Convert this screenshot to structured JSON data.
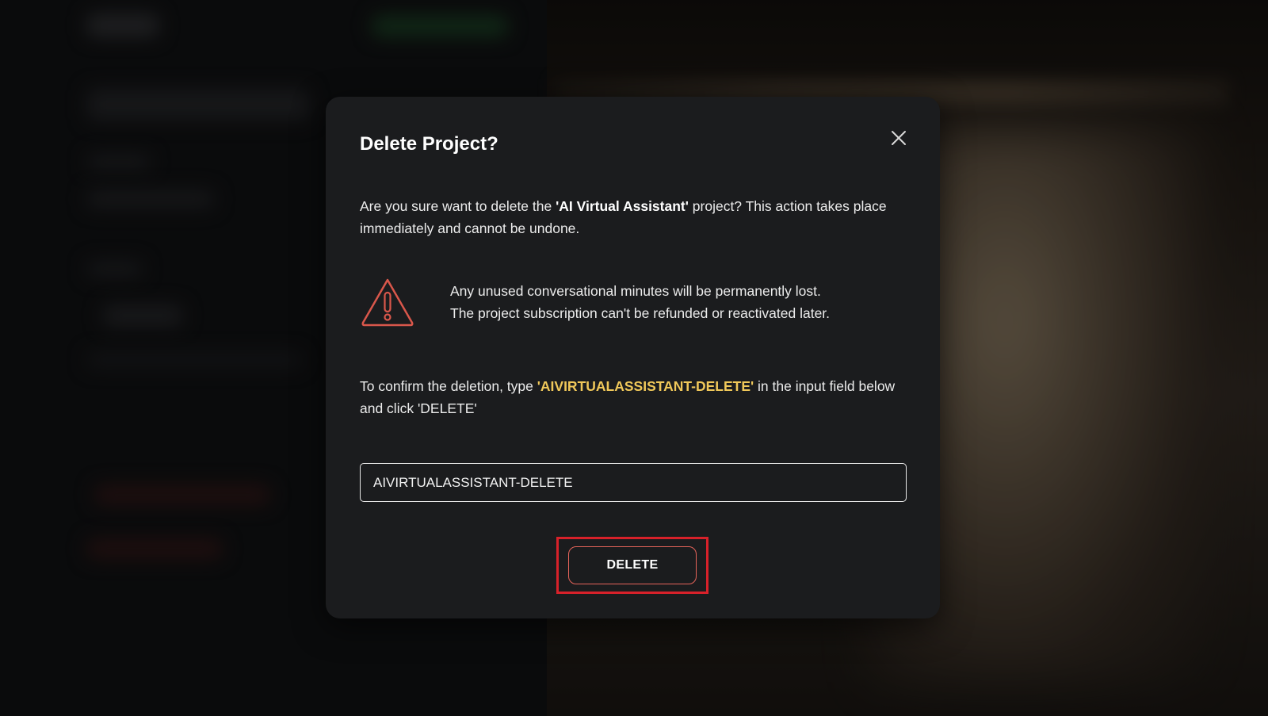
{
  "modal": {
    "title": "Delete Project?",
    "intro_prefix": "Are you sure want to delete the ",
    "project_name_quoted": "'AI Virtual Assistant'",
    "intro_suffix": " project? This action takes place immediately and cannot be undone.",
    "warning_line_1": "Any unused conversational minutes will be permanently lost.",
    "warning_line_2": "The project subscription can't be refunded or reactivated later.",
    "confirm_prefix": "To confirm the deletion, type ",
    "confirm_code_quoted": "'AIVIRTUALASSISTANT-DELETE'",
    "confirm_suffix": " in the input field below and click 'DELETE'",
    "input_value": "AIVIRTUALASSISTANT-DELETE",
    "delete_label": "DELETE"
  },
  "colors": {
    "modal_bg": "#1b1c1e",
    "warning_icon": "#d9574b",
    "code_highlight": "#f0c85a",
    "delete_border": "#e6645a",
    "annotation_box": "#d8212a"
  },
  "icons": {
    "close": "close-icon",
    "warning": "warning-triangle-icon"
  }
}
